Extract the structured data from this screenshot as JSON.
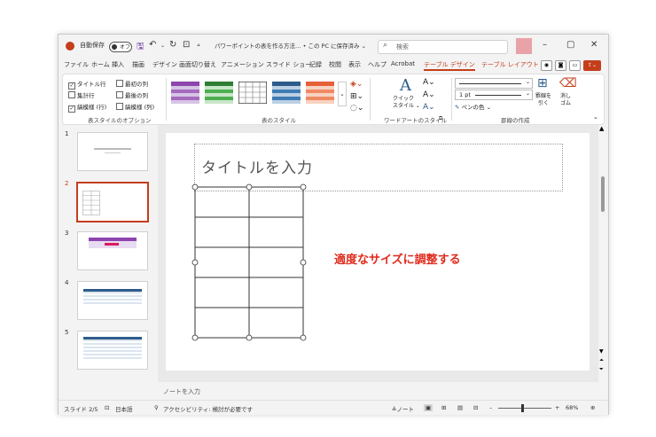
{
  "titlebar": {
    "autosave_label": "自動保存",
    "autosave_state": "オフ",
    "doc_title": "パワーポイントの表を作る方法… • この PC に保存済み ⌄",
    "search_placeholder": "検索"
  },
  "tabs": [
    "ファイル",
    "ホーム",
    "挿入",
    "描画",
    "デザイン",
    "画面切り替え",
    "アニメーション",
    "スライド ショー",
    "記録",
    "校閲",
    "表示",
    "ヘルプ",
    "Acrobat",
    "テーブル デザイン",
    "テーブル レイアウト"
  ],
  "ribbon": {
    "style_options": {
      "items": [
        "タイトル行",
        "最初の列",
        "集計行",
        "最後の列",
        "縞模様 (行)",
        "縞模様 (列)"
      ],
      "label": "表スタイルのオプション"
    },
    "table_styles_label": "表のスタイル",
    "wordart": {
      "quick_style": "クイック\nスタイル ⌄",
      "label": "ワードアートのスタイル"
    },
    "borders": {
      "weight": "1 pt",
      "pen_color": "ペンの色 ⌄",
      "draw": "罫線を\n引く",
      "erase": "消し\nゴム",
      "label": "罫線の作成"
    }
  },
  "slides": [
    {
      "num": "1"
    },
    {
      "num": "2"
    },
    {
      "num": "3"
    },
    {
      "num": "4"
    },
    {
      "num": "5"
    }
  ],
  "editor": {
    "title_placeholder": "タイトルを入力",
    "annotation": "適度なサイズに調整する",
    "notes_placeholder": "ノートを入力"
  },
  "status": {
    "slide": "スライド 2/5",
    "language": "日本語",
    "accessibility": "アクセシビリティ: 検討が必要です",
    "notes_btn": "≜ノート",
    "zoom": "68%"
  },
  "colors": {
    "accent": "#c43e1c",
    "annotation": "#e02a1c"
  }
}
